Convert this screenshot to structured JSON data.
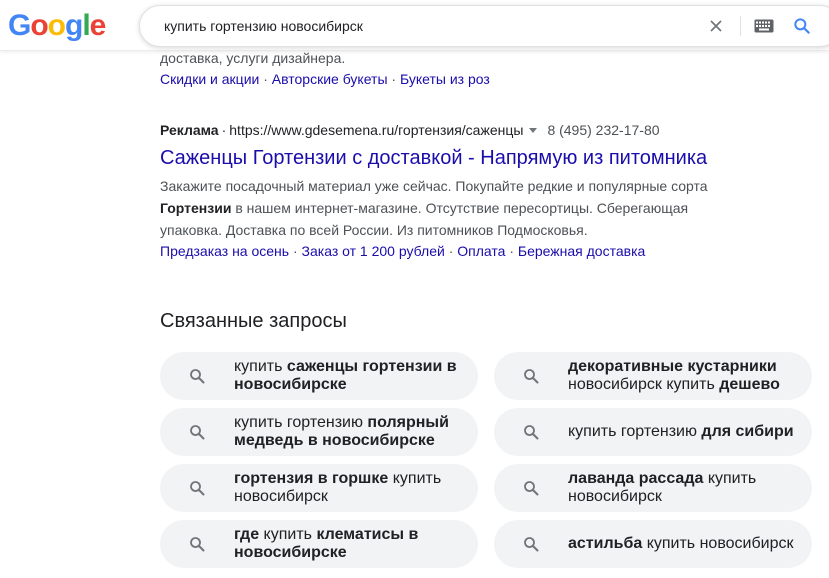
{
  "logo": {
    "letters": [
      "G",
      "o",
      "o",
      "g",
      "l",
      "e"
    ],
    "colors": [
      "#4285F4",
      "#EA4335",
      "#FBBC05",
      "#4285F4",
      "#34A853",
      "#EA4335"
    ]
  },
  "search": {
    "query": "купить гортензию новосибирск"
  },
  "previous_result": {
    "snippet_tail": "доставка, услуги дизайнера.",
    "sitelinks": [
      "Скидки и акции",
      "Авторские букеты",
      "Букеты из роз"
    ]
  },
  "ad": {
    "label": "Реклама",
    "url": "https://www.gdesemena.ru/гортензия/саженцы",
    "phone": "8 (495) 232-17-80",
    "title": "Саженцы Гортензии с доставкой - Напрямую из питомника",
    "desc_part1": "Закажите посадочный материал уже сейчас. Покупайте редкие и популярные сорта ",
    "desc_bold": "Гортензии",
    "desc_part2": " в нашем интернет-магазине. Отсутствие пересортицы. Сберегающая упаковка. Доставка по всей России. Из питомников Подмосковья.",
    "sitelinks": [
      "Предзаказ на осень",
      "Заказ от 1 200 рублей",
      "Оплата",
      "Бережная доставка"
    ]
  },
  "related": {
    "title": "Связанные запросы",
    "items": [
      {
        "segments": [
          {
            "t": "купить ",
            "b": false
          },
          {
            "t": "саженцы гортензии в новосибирске",
            "b": true
          }
        ]
      },
      {
        "segments": [
          {
            "t": "декоративные кустарники",
            "b": true
          },
          {
            "t": " новосибирск купить ",
            "b": false
          },
          {
            "t": "дешево",
            "b": true
          }
        ]
      },
      {
        "segments": [
          {
            "t": "купить гортензию ",
            "b": false
          },
          {
            "t": "полярный медведь в новосибирске",
            "b": true
          }
        ]
      },
      {
        "segments": [
          {
            "t": "купить гортензию ",
            "b": false
          },
          {
            "t": "для сибири",
            "b": true
          }
        ]
      },
      {
        "segments": [
          {
            "t": "гортензия в горшке",
            "b": true
          },
          {
            "t": " купить новосибирск",
            "b": false
          }
        ]
      },
      {
        "segments": [
          {
            "t": "лаванда рассада",
            "b": true
          },
          {
            "t": " купить новосибирск",
            "b": false
          }
        ]
      },
      {
        "segments": [
          {
            "t": "где",
            "b": true
          },
          {
            "t": " купить ",
            "b": false
          },
          {
            "t": "клематисы в новосибирске",
            "b": true
          }
        ]
      },
      {
        "segments": [
          {
            "t": "астильба",
            "b": true
          },
          {
            "t": " купить новосибирск",
            "b": false
          }
        ]
      }
    ]
  },
  "colors": {
    "link": "#1a0dab",
    "text": "#202124",
    "muted": "#4d5156",
    "chip_bg": "#f1f3f4",
    "search_icon": "#4285F4"
  },
  "icons": {
    "clear": "close-icon",
    "keyboard": "keyboard-icon",
    "search": "search-icon"
  }
}
